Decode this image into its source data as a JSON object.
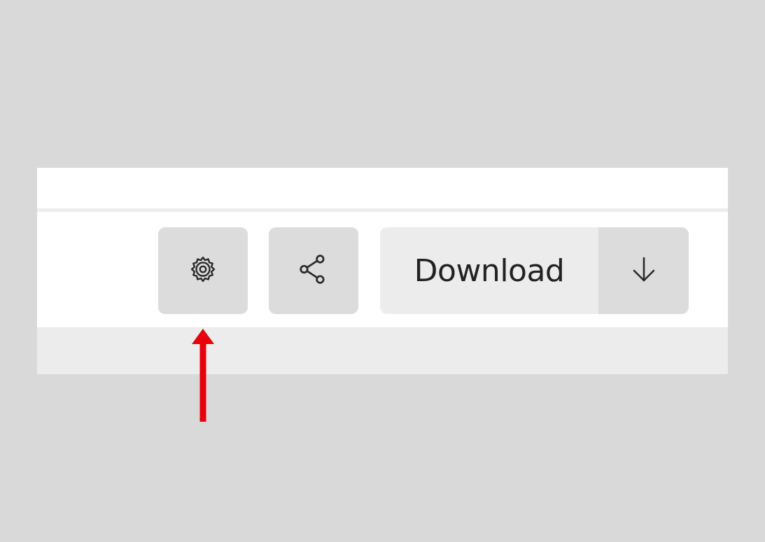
{
  "toolbar": {
    "settings": {
      "icon": "gear-icon"
    },
    "share": {
      "icon": "share-icon"
    },
    "download": {
      "label": "Download",
      "dropdown_icon": "arrow-down-icon"
    }
  },
  "annotation": {
    "icon": "red-arrow-up-icon",
    "color": "#e8000b"
  }
}
